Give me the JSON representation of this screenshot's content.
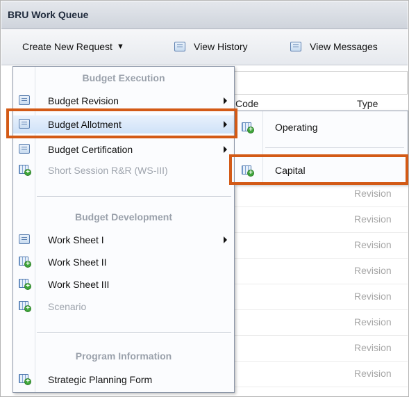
{
  "window": {
    "title": "BRU Work Queue"
  },
  "toolbar": {
    "create_label": "Create New Request",
    "create_caret": "▼",
    "history_label": "View History",
    "messages_label": "View Messages"
  },
  "grid": {
    "headers": {
      "code": "Code",
      "type": "Type"
    },
    "rows": [
      "Revision",
      "Revision",
      "Revision",
      "Revision",
      "Revision",
      "Revision",
      "Revision",
      "Revision"
    ]
  },
  "menu": {
    "sections": {
      "execution": "Budget Execution",
      "development": "Budget Development",
      "program": "Program Information"
    },
    "items": [
      {
        "label": "Budget Revision",
        "icon": "list-icon",
        "submenu": true,
        "disabled": false
      },
      {
        "label": "Budget Allotment",
        "icon": "list-icon",
        "submenu": true,
        "disabled": false,
        "highlighted": true
      },
      {
        "label": "Budget Certification",
        "icon": "list-icon",
        "submenu": true,
        "disabled": false
      },
      {
        "label": "Short Session R&R (WS-III)",
        "icon": "sheet-add-icon",
        "submenu": false,
        "disabled": true
      },
      {
        "label": "Work Sheet I",
        "icon": "list-icon",
        "submenu": true,
        "disabled": false
      },
      {
        "label": "Work Sheet II",
        "icon": "sheet-add-icon",
        "submenu": false,
        "disabled": false
      },
      {
        "label": "Work Sheet III",
        "icon": "sheet-add-icon",
        "submenu": false,
        "disabled": false
      },
      {
        "label": "Scenario",
        "icon": "sheet-add-icon",
        "submenu": false,
        "disabled": true
      },
      {
        "label": "Strategic Planning Form",
        "icon": "sheet-add-icon",
        "submenu": false,
        "disabled": false
      }
    ]
  },
  "submenu": {
    "items": [
      {
        "label": "Operating",
        "icon": "sheet-add-icon"
      },
      {
        "label": "Capital",
        "icon": "sheet-add-icon",
        "highlighted": true
      }
    ]
  },
  "colors": {
    "highlight_box": "#d35a16",
    "hover_bg": "#cfe2f8",
    "disabled_text": "#9ea4ad"
  }
}
